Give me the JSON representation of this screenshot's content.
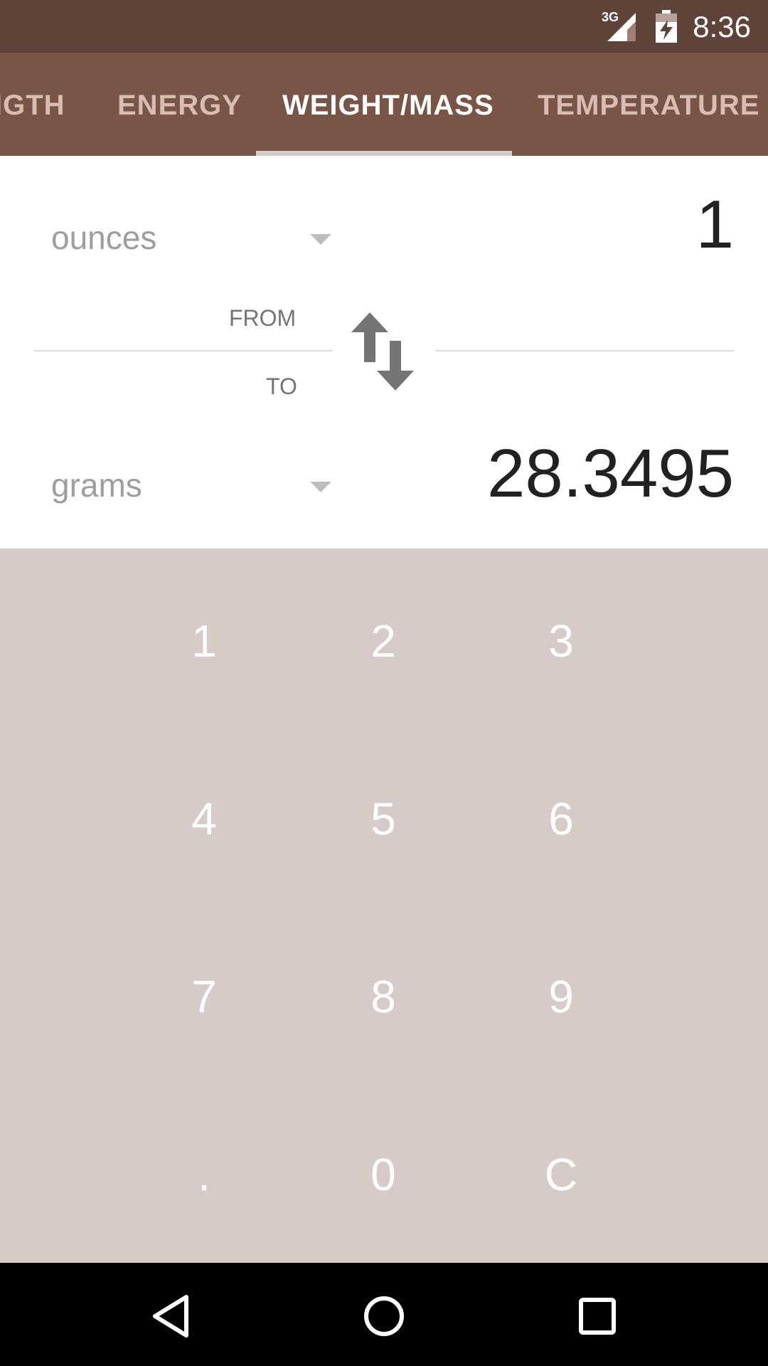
{
  "status_bar": {
    "network": "3G",
    "time": "8:36"
  },
  "tabs": [
    {
      "label": "IGTH",
      "active": false
    },
    {
      "label": "ENERGY",
      "active": false
    },
    {
      "label": "WEIGHT/MASS",
      "active": true
    },
    {
      "label": "TEMPERATURE",
      "active": false
    }
  ],
  "converter": {
    "from_unit": "ounces",
    "from_value": "1",
    "from_label": "FROM",
    "to_label": "TO",
    "to_unit": "grams",
    "to_value": "28.3495"
  },
  "keypad": {
    "keys": [
      "1",
      "2",
      "3",
      "4",
      "5",
      "6",
      "7",
      "8",
      "9",
      ".",
      "0",
      "C"
    ]
  },
  "colors": {
    "status_bar": "#5f4339",
    "tab_bar": "#795548",
    "keypad_bg": "#d7cbc8"
  },
  "icons": {
    "swap": "swap-vertical-icon",
    "back": "back-icon",
    "home": "home-icon",
    "recents": "recents-icon"
  }
}
